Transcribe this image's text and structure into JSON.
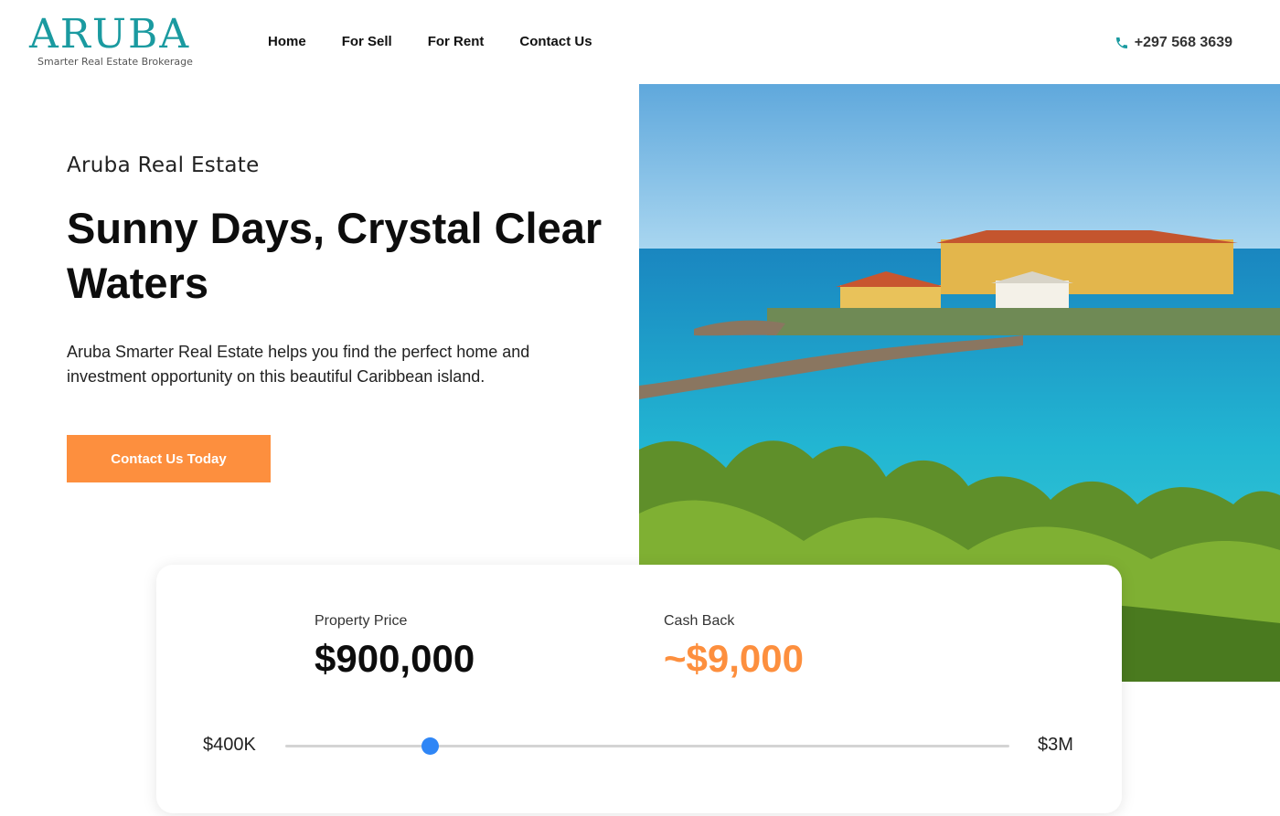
{
  "brand": {
    "logo_text": "ARUBA",
    "tagline": "Smarter Real Estate Brokerage",
    "accent_color": "#1a9aa0",
    "dot_color": "#c0124a"
  },
  "nav": {
    "items": [
      {
        "label": "Home"
      },
      {
        "label": "For Sell"
      },
      {
        "label": "For Rent"
      },
      {
        "label": "Contact Us"
      }
    ]
  },
  "contact": {
    "icon": "phone-icon",
    "phone": "+297 568 3639"
  },
  "hero": {
    "eyebrow": "Aruba Real Estate",
    "headline": "Sunny Days, Crystal Clear Waters",
    "description": "Aruba Smarter Real Estate helps you find the perfect home and investment opportunity on this beautiful Caribbean island.",
    "cta_label": "Contact Us Today",
    "cta_color": "#fd8f3e"
  },
  "calculator": {
    "price_label": "Property Price",
    "price_value": "$900,000",
    "cashback_label": "Cash Back",
    "cashback_value": "~$9,000",
    "range_min_label": "$400K",
    "range_max_label": "$3M",
    "slider_value_fraction": 0.2,
    "slider_color": "#2f86f6"
  }
}
